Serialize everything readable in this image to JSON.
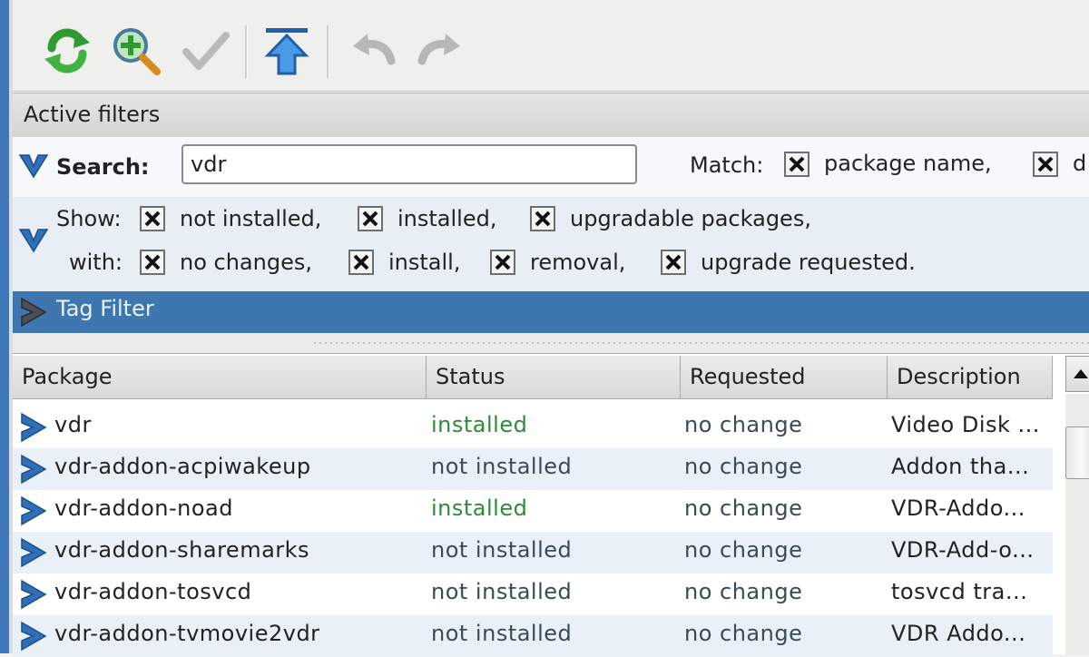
{
  "toolbar": {
    "icons": [
      "refresh-icon",
      "zoom-in-icon",
      "apply-check-icon",
      "upgrade-all-icon",
      "undo-icon",
      "redo-icon"
    ]
  },
  "filters": {
    "header": "Active filters",
    "search_label": "Search:",
    "search_value": "vdr",
    "match_label": "Match:",
    "match_options": [
      "package name,",
      "d"
    ],
    "show_label": "Show:",
    "show_options": [
      "not installed,",
      "installed,",
      "upgradable packages,"
    ],
    "with_label": "with:",
    "with_options": [
      "no changes,",
      "install,",
      "removal,",
      "upgrade requested."
    ]
  },
  "tag_filter": {
    "label": "Tag Filter"
  },
  "table": {
    "columns": [
      "Package",
      "Status",
      "Requested",
      "Description"
    ],
    "rows": [
      {
        "package": "vdr",
        "status": "installed",
        "requested": "no change",
        "description": "Video Disk ..."
      },
      {
        "package": "vdr-addon-acpiwakeup",
        "status": "not installed",
        "requested": "no change",
        "description": "Addon tha..."
      },
      {
        "package": "vdr-addon-noad",
        "status": "installed",
        "requested": "no change",
        "description": "VDR-Addo..."
      },
      {
        "package": "vdr-addon-sharemarks",
        "status": "not installed",
        "requested": "no change",
        "description": "VDR-Add-o..."
      },
      {
        "package": "vdr-addon-tosvcd",
        "status": "not installed",
        "requested": "no change",
        "description": "tosvcd tra..."
      },
      {
        "package": "vdr-addon-tvmovie2vdr",
        "status": "not installed",
        "requested": "no change",
        "description": "VDR Addo..."
      }
    ]
  },
  "colors": {
    "accent_blue": "#3e77b0",
    "installed_green": "#2e8b3a"
  }
}
